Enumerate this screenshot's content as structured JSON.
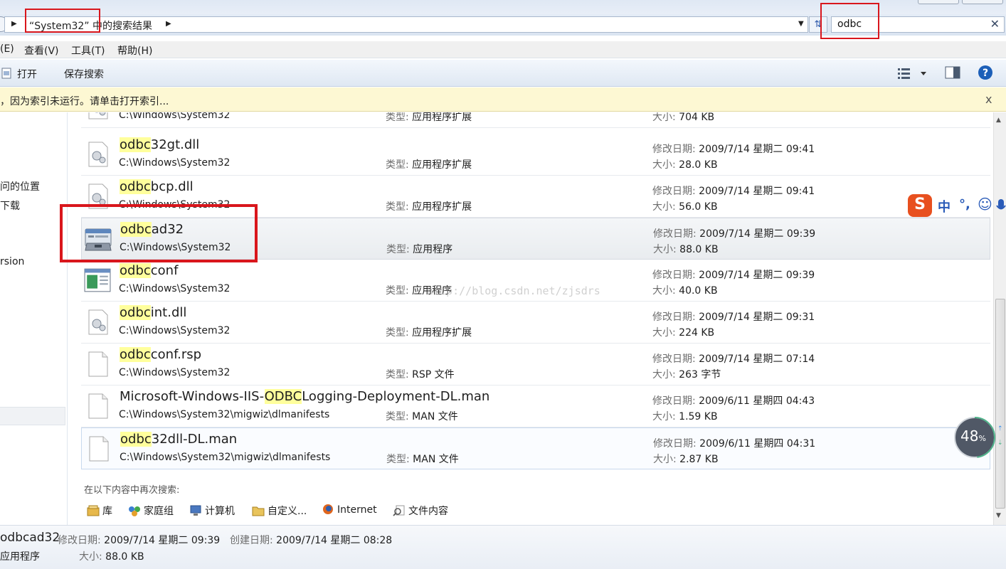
{
  "address": {
    "path": "“System32” 中的搜索结果",
    "search_value": "odbc"
  },
  "menu": {
    "items": [
      "(E)",
      "查看(V)",
      "工具(T)",
      "帮助(H)"
    ]
  },
  "toolbar": {
    "open_label": "打开",
    "save_search_label": "保存搜索"
  },
  "info_bar": {
    "message": "，因为索引未运行。请单击打开索引...",
    "close": "x"
  },
  "nav": {
    "items": [
      "问的位置",
      "下载",
      "rsion"
    ]
  },
  "results": {
    "type_label": "类型:",
    "date_label": "修改日期:",
    "size_label": "大小:",
    "rows": [
      {
        "highlight": "",
        "rest": "",
        "path": "C:\\Windows\\System32",
        "type": "应用程序扩展",
        "date": "",
        "size": "704 KB",
        "icon": "dll-icon"
      },
      {
        "highlight": "odbc",
        "rest": "32gt.dll",
        "path": "C:\\Windows\\System32",
        "type": "应用程序扩展",
        "date": "2009/7/14 星期二 09:41",
        "size": "28.0 KB",
        "icon": "dll-icon"
      },
      {
        "highlight": "odbc",
        "rest": "bcp.dll",
        "path": "C:\\Windows\\System32",
        "type": "应用程序扩展",
        "date": "2009/7/14 星期二 09:41",
        "size": "56.0 KB",
        "icon": "dll-icon"
      },
      {
        "highlight": "odbc",
        "rest": "ad32",
        "path": "C:\\Windows\\System32",
        "type": "应用程序",
        "date": "2009/7/14 星期二 09:39",
        "size": "88.0 KB",
        "icon": "toolbox-icon"
      },
      {
        "highlight": "odbc",
        "rest": "conf",
        "path": "C:\\Windows\\System32",
        "type": "应用程序",
        "date": "2009/7/14 星期二 09:39",
        "size": "40.0 KB",
        "icon": "app-window-icon"
      },
      {
        "highlight": "odbc",
        "rest": "int.dll",
        "path": "C:\\Windows\\System32",
        "type": "应用程序扩展",
        "date": "2009/7/14 星期二 09:31",
        "size": "224 KB",
        "icon": "dll-icon"
      },
      {
        "highlight": "odbc",
        "rest": "conf.rsp",
        "path": "C:\\Windows\\System32",
        "type": "RSP 文件",
        "date": "2009/7/14 星期二 07:14",
        "size": "263 字节",
        "icon": "blank-file-icon"
      },
      {
        "prefix": "Microsoft-Windows-IIS-",
        "highlight": "ODBC",
        "rest": "Logging-Deployment-DL.man",
        "path": "C:\\Windows\\System32\\migwiz\\dlmanifests",
        "type": "MAN 文件",
        "date": "2009/6/11 星期四 04:43",
        "size": "1.59 KB",
        "icon": "blank-file-icon"
      },
      {
        "highlight": "odbc",
        "rest": "32dll-DL.man",
        "path": "C:\\Windows\\System32\\migwiz\\dlmanifests",
        "type": "MAN 文件",
        "date": "2009/6/11 星期四 04:31",
        "size": "2.87 KB",
        "icon": "blank-file-icon"
      }
    ]
  },
  "search_again": {
    "title": "在以下内容中再次搜索:",
    "items": [
      "库",
      "家庭组",
      "计算机",
      "自定义...",
      "Internet",
      "文件内容"
    ]
  },
  "watermark": "http://blog.csdn.net/zjsdrs",
  "ime": {
    "logo": "S",
    "mode": "中",
    "punct": "°,",
    "emoji": "☺"
  },
  "progress": {
    "value": "48",
    "unit": "%"
  },
  "details": {
    "name": "odbcad32",
    "modified_label": "修改日期:",
    "modified": "2009/7/14 星期二 09:39",
    "created_label": "创建日期:",
    "created": "2009/7/14 星期二 08:28",
    "type": "应用程序",
    "size_label": "大小:",
    "size": "88.0 KB"
  },
  "colors": {
    "highlight": "#ffff9c",
    "annotation_red": "#d9161c",
    "accent_blue": "#1c5fb8"
  }
}
